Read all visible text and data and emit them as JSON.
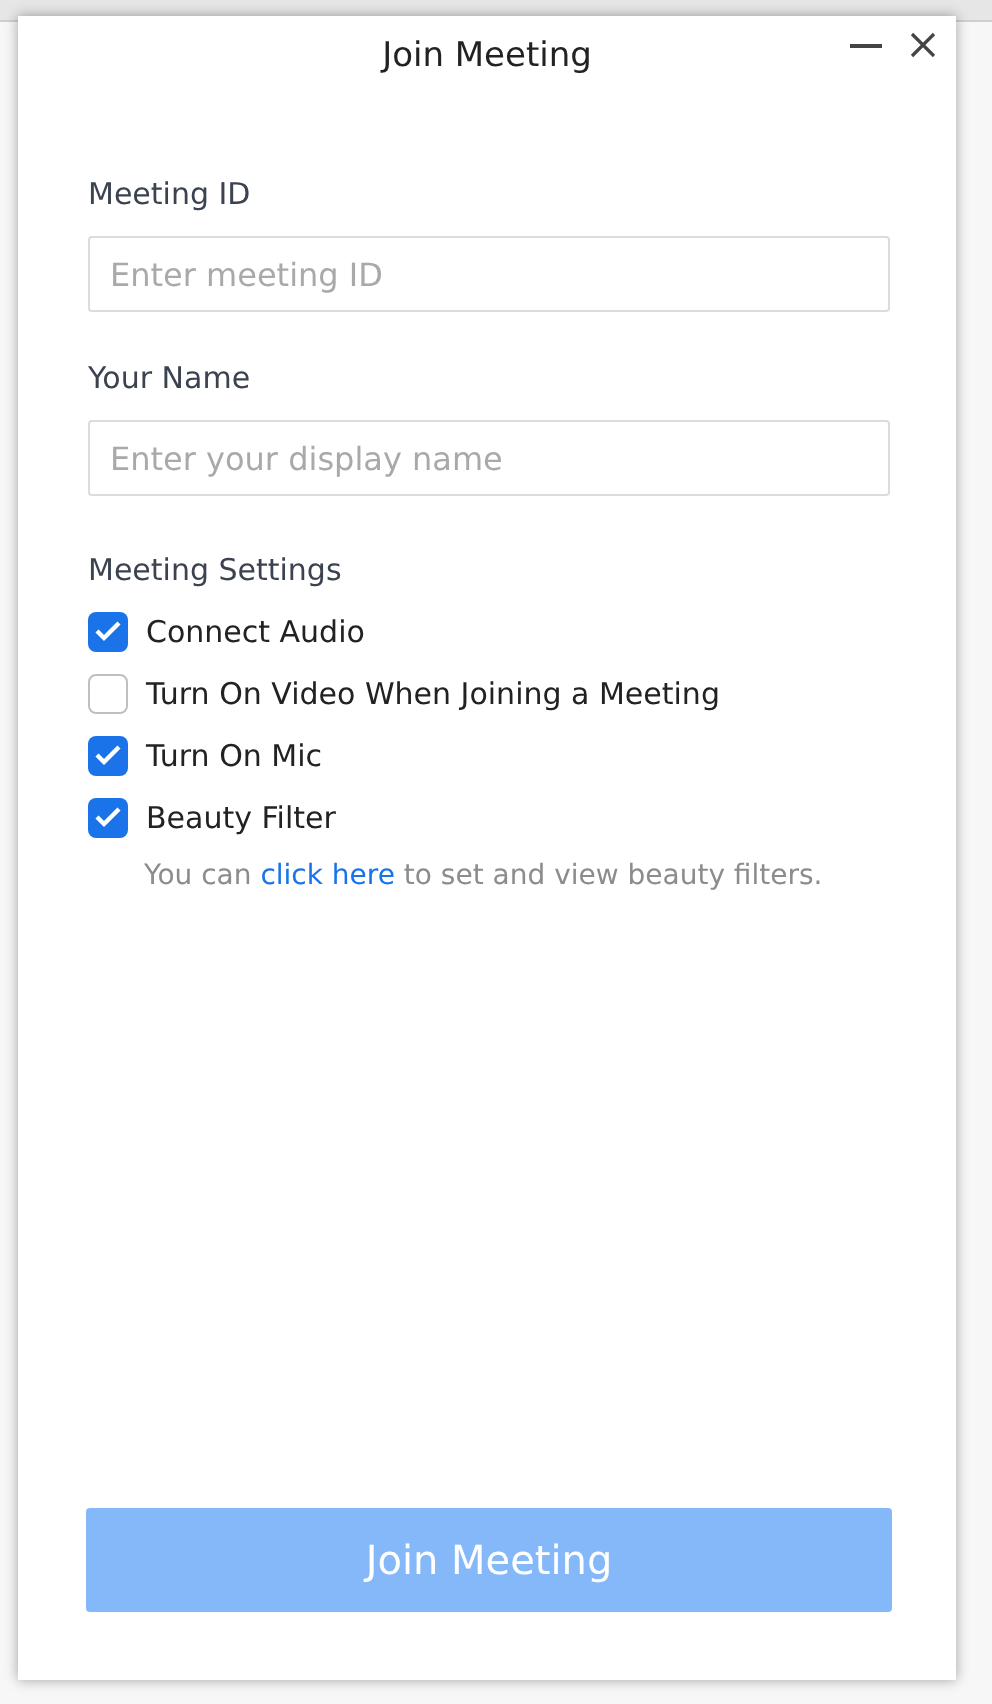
{
  "window": {
    "title": "Join Meeting"
  },
  "fields": [
    {
      "label": "Meeting ID",
      "placeholder": "Enter meeting ID"
    },
    {
      "label": "Your Name",
      "placeholder": "Enter your display name"
    }
  ],
  "settings": {
    "heading": "Meeting Settings",
    "options": [
      {
        "label": "Connect Audio",
        "checked": true
      },
      {
        "label": "Turn On Video When Joining a Meeting",
        "checked": false
      },
      {
        "label": "Turn On Mic",
        "checked": true
      },
      {
        "label": "Beauty Filter",
        "checked": true
      }
    ],
    "hint": {
      "before": "You can",
      "link": "click here",
      "after": "to set and view beauty filters."
    }
  },
  "join_button": {
    "label": "Join Meeting",
    "disabled": true
  }
}
